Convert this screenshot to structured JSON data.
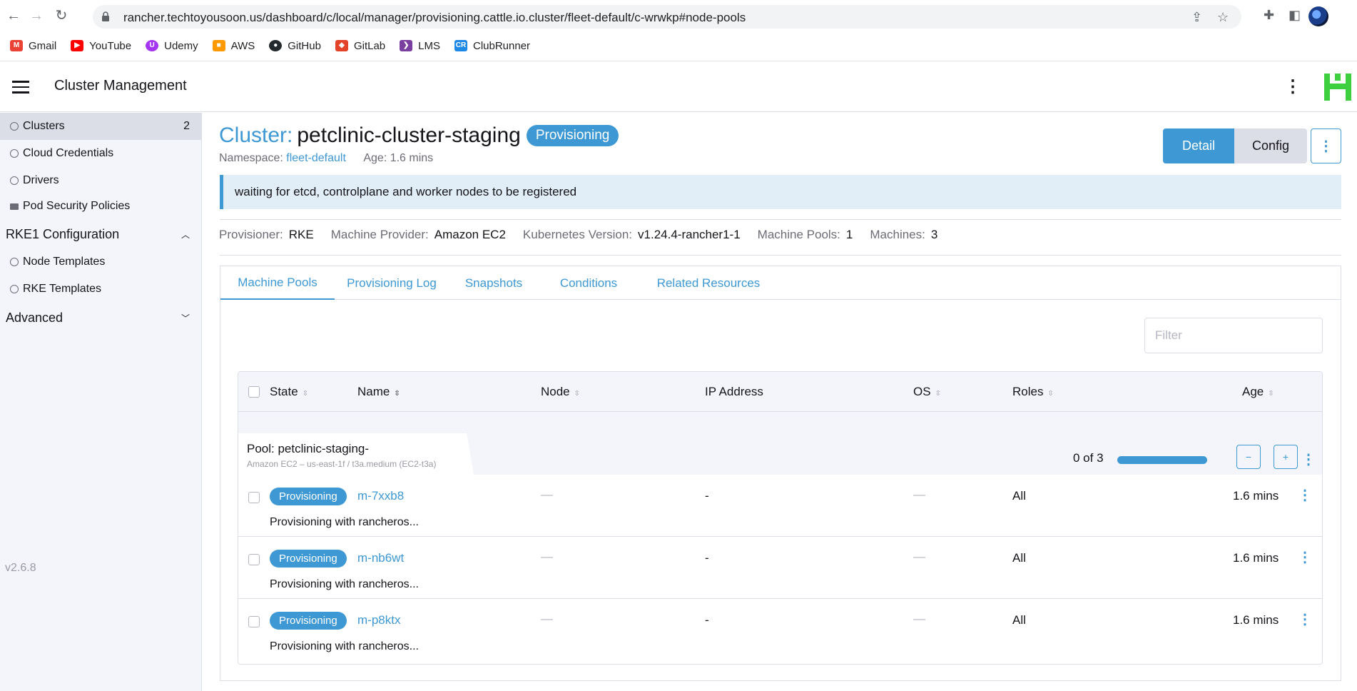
{
  "browser": {
    "url": "rancher.techtoyousoon.us/dashboard/c/local/manager/provisioning.cattle.io.cluster/fleet-default/c-wrwkp#node-pools",
    "bookmarks": [
      {
        "label": "Gmail",
        "color": "#ea4335",
        "glyph": "M"
      },
      {
        "label": "YouTube",
        "color": "#ff0000",
        "glyph": "▶"
      },
      {
        "label": "Udemy",
        "color": "#a435f0",
        "glyph": "U"
      },
      {
        "label": "AWS",
        "color": "#ff9900",
        "glyph": "■"
      },
      {
        "label": "GitHub",
        "color": "#24292e",
        "glyph": "●"
      },
      {
        "label": "GitLab",
        "color": "#e24329",
        "glyph": "◆"
      },
      {
        "label": "LMS",
        "color": "#7b3fa0",
        "glyph": "❯"
      },
      {
        "label": "ClubRunner",
        "color": "#1e88e5",
        "glyph": "CR"
      }
    ]
  },
  "header": {
    "title": "Cluster Management"
  },
  "sidebar": {
    "items": [
      {
        "label": "Clusters",
        "count": "2",
        "icon": "globe-icon"
      },
      {
        "label": "Cloud Credentials",
        "icon": "globe-icon"
      },
      {
        "label": "Drivers",
        "icon": "globe-icon"
      },
      {
        "label": "Pod Security Policies",
        "icon": "folder-icon"
      }
    ],
    "groups": [
      {
        "label": "RKE1 Configuration",
        "items": [
          "Node Templates",
          "RKE Templates"
        ]
      },
      {
        "label": "Advanced"
      }
    ],
    "version": "v2.6.8"
  },
  "cluster": {
    "prefix": "Cluster:",
    "name": "petclinic-cluster-staging",
    "state": "Provisioning",
    "namespace_label": "Namespace:",
    "namespace": "fleet-default",
    "age": "Age: 1.6 mins",
    "banner": "waiting for etcd, controlplane and worker nodes to be registered",
    "detail_label": "Detail",
    "config_label": "Config",
    "info": [
      {
        "label": "Provisioner:",
        "value": "RKE"
      },
      {
        "label": "Machine Provider:",
        "value": "Amazon EC2"
      },
      {
        "label": "Kubernetes Version:",
        "value": "v1.24.4-rancher1-1"
      },
      {
        "label": "Machine Pools:",
        "value": "1"
      },
      {
        "label": "Machines:",
        "value": "3"
      }
    ]
  },
  "tabs": [
    "Machine Pools",
    "Provisioning Log",
    "Snapshots",
    "Conditions",
    "Related Resources"
  ],
  "filter_placeholder": "Filter",
  "table": {
    "columns": [
      "State",
      "Name",
      "Node",
      "IP Address",
      "OS",
      "Roles",
      "Age"
    ],
    "pool": {
      "title": "Pool: petclinic-staging-",
      "subtitle": "Amazon EC2 – us-east-1f / t3a.medium (EC2-t3a)",
      "count": "0 of 3",
      "progress": 1.0
    },
    "rows": [
      {
        "state": "Provisioning",
        "name": "m-7xxb8",
        "node": "—",
        "ip": "-",
        "os": "—",
        "roles": "All",
        "age": "1.6 mins",
        "message": "Provisioning with rancheros..."
      },
      {
        "state": "Provisioning",
        "name": "m-nb6wt",
        "node": "—",
        "ip": "-",
        "os": "—",
        "roles": "All",
        "age": "1.6 mins",
        "message": "Provisioning with rancheros..."
      },
      {
        "state": "Provisioning",
        "name": "m-p8ktx",
        "node": "—",
        "ip": "-",
        "os": "—",
        "roles": "All",
        "age": "1.6 mins",
        "message": "Provisioning with rancheros..."
      }
    ]
  },
  "colors": {
    "accent": "#3d98d3",
    "sidebar_bg": "#f4f5fa",
    "banner_bg": "#e2eef7"
  }
}
